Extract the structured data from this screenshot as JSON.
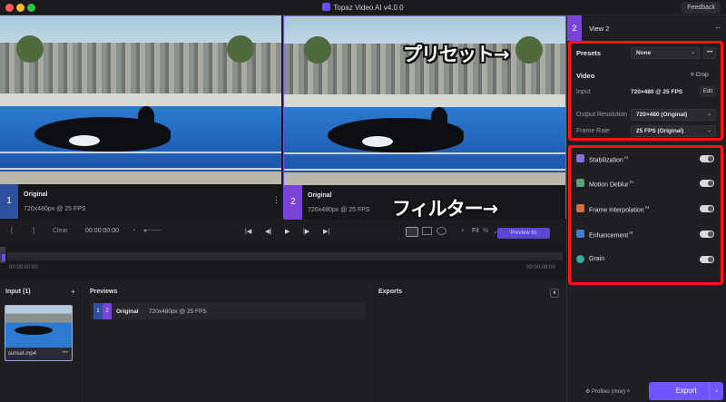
{
  "window": {
    "title": "Topaz Video AI  v4.0.0",
    "feedback": "Feedback"
  },
  "views": [
    {
      "number": "1",
      "name": "Original",
      "meta": "720x480px @ 25 FPS",
      "color": "#2f4fa0"
    },
    {
      "number": "2",
      "name": "Original",
      "meta": "720x480px @ 25 FPS",
      "color": "#7a45d6"
    }
  ],
  "controls": {
    "in": "[",
    "out": "]",
    "clear": "Clear",
    "timecode": "00:00:00:00",
    "fit": "Fit",
    "zoom": "%",
    "preview": "Preview 6s"
  },
  "timeline": {
    "start": "00:00:00:00",
    "end": "00:00:08:00"
  },
  "input_panel": {
    "title": "Input (1)",
    "add": "+",
    "file": "sunset.mp4",
    "more": "•••"
  },
  "previews_panel": {
    "title": "Previews",
    "row": {
      "n1": "1",
      "n2": "2",
      "name": "Original",
      "meta": "720x480px @ 25 FPS"
    }
  },
  "exports_panel": {
    "title": "Exports",
    "menu": "⬍"
  },
  "sidebar": {
    "view_number": "2",
    "view_title": "View 2",
    "presets_label": "Presets",
    "presets_value": "None",
    "video_label": "Video",
    "crop": "Crop",
    "input_label": "Input",
    "input_value": "720×480 @ 25 FPS",
    "edit": "Edit",
    "output_label": "Output Resolution",
    "output_value": "720×480 (Original)",
    "framerate_label": "Frame Rate",
    "framerate_value": "25 FPS (Original)",
    "filters": [
      {
        "name": "Stabilization",
        "ai": "AI",
        "color": "#8a6dd8"
      },
      {
        "name": "Motion Deblur",
        "ai": "AI",
        "color": "#5aa27a"
      },
      {
        "name": "Frame Interpolation",
        "ai": "AI",
        "color": "#d86a3c"
      },
      {
        "name": "Enhancement",
        "ai": "AI",
        "color": "#3c7fd0"
      },
      {
        "name": "Grain",
        "ai": "",
        "color": "#2fb0a0"
      }
    ],
    "profiles": "Profiles (mov)",
    "export": "Export"
  },
  "annotations": {
    "presets": "プリセット→",
    "filters": "フィルター→"
  }
}
